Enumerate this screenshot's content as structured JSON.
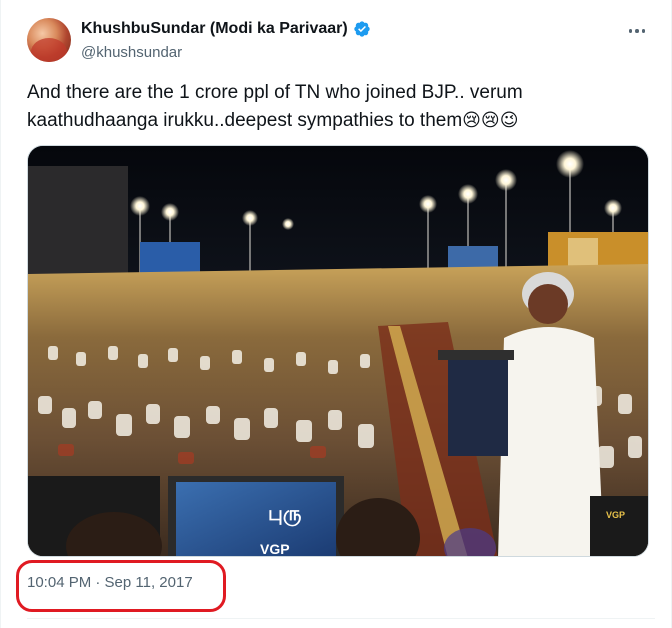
{
  "tweet": {
    "display_name": "KhushbuSundar (Modi ka Parivaar)",
    "handle": "@khushsundar",
    "text": "And there are the 1 crore ppl of TN who joined BJP.. verum kaathudhaanga irukku..deepest sympathies to them",
    "emojis": "😢😢😉",
    "timestamp": "10:04 PM · Sep 11, 2017"
  },
  "media": {
    "screen_label": "VGP",
    "screen_title": "புரு",
    "podium_label": "VGP"
  },
  "icons": {
    "verified": "verified-badge-icon",
    "more": "more-options-icon"
  },
  "colors": {
    "text": "#0f1419",
    "secondary": "#536471",
    "verified": "#1d9bf0",
    "highlight": "#e01a22"
  }
}
